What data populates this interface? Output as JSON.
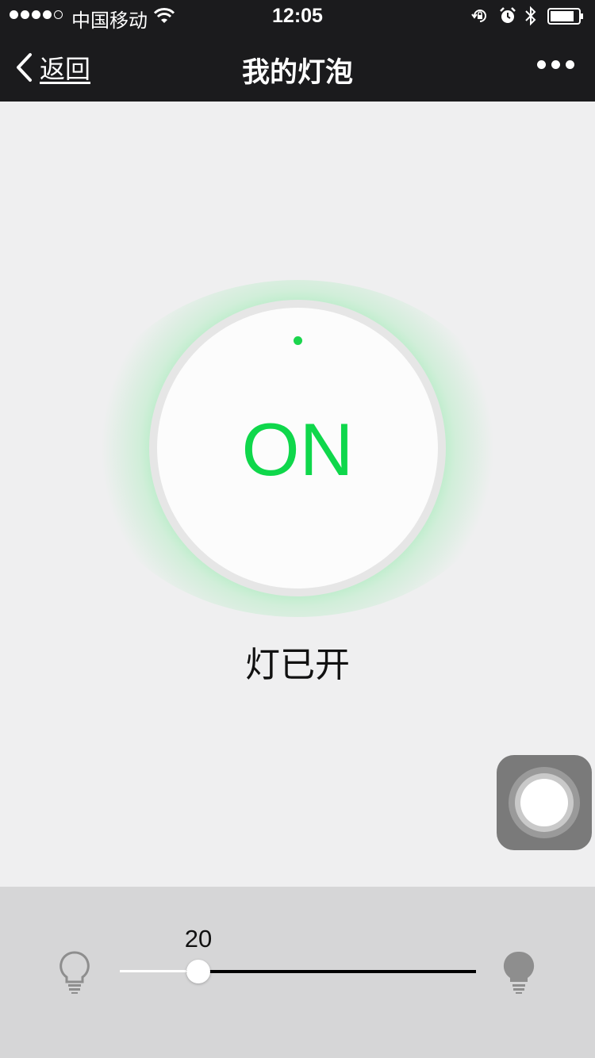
{
  "status_bar": {
    "carrier": "中国移动",
    "time": "12:05",
    "signal_bars": 4,
    "signal_total": 5,
    "battery_level": 0.85
  },
  "nav": {
    "back_label": "返回",
    "title": "我的灯泡"
  },
  "lamp": {
    "state_text": "ON",
    "status_label": "灯已开",
    "accent_color": "#0fd74b"
  },
  "brightness": {
    "value": "20",
    "level_fraction": 0.186
  },
  "icons": {
    "back": "chevron-left-icon",
    "more": "more-dots-icon",
    "dim": "bulb-outline-icon",
    "bright": "bulb-filled-icon",
    "assistive": "assistive-touch-icon"
  }
}
